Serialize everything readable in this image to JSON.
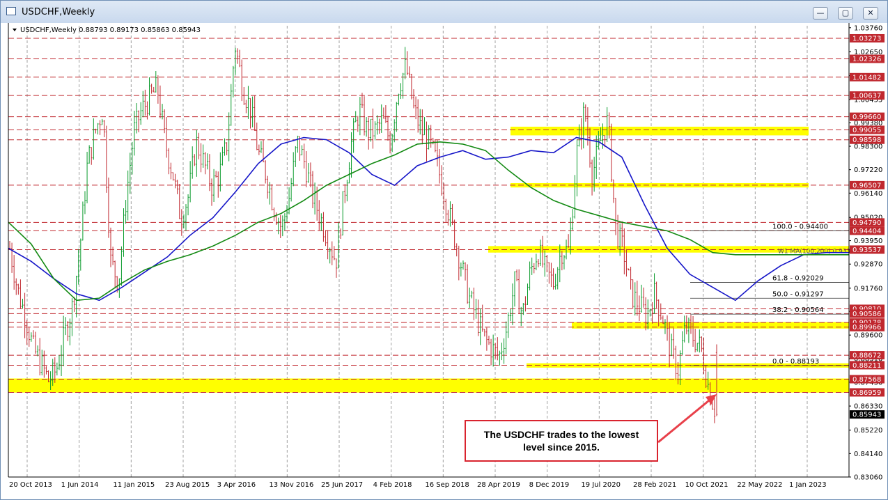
{
  "window": {
    "title": "USDCHF,Weekly",
    "buttons": {
      "minimize": "—",
      "maximize": "▢",
      "close": "✕"
    }
  },
  "colors": {
    "bull_candle": "#0a9b2c",
    "bear_candle": "#c0282f",
    "ma_blue": "#1515c8",
    "ma_green": "#138a13",
    "level_line": "#c0282f",
    "zone_yellow": "#ffff00",
    "price_tag": "#c0282f",
    "current_tag": "#000000"
  },
  "chart_data": {
    "type": "candlestick",
    "symbol": "USDCHF",
    "timeframe": "Weekly",
    "header": "USDCHF,Weekly  0.88793 0.89173 0.85863 0.85943",
    "ohlc_last": {
      "open": 0.88793,
      "high": 0.89173,
      "low": 0.85863,
      "close": 0.85943
    },
    "ylim": [
      0.8306,
      1.0385
    ],
    "y_ticks": [
      "1.03760",
      "1.02650",
      "1.01550",
      "1.00455",
      "0.99380",
      "0.98300",
      "0.97220",
      "0.96140",
      "0.95020",
      "0.93950",
      "0.92870",
      "0.91760",
      "0.90690",
      "0.89600",
      "0.88510",
      "0.87430",
      "0.86330",
      "0.85220",
      "0.84140",
      "0.83060"
    ],
    "x_labels": [
      "20 Oct 2013",
      "1 Jun 2014",
      "11 Jan 2015",
      "23 Aug 2015",
      "3 Apr 2016",
      "13 Nov 2016",
      "25 Jun 2017",
      "4 Feb 2018",
      "16 Sep 2018",
      "28 Apr 2019",
      "8 Dec 2019",
      "19 Jul 2020",
      "28 Feb 2021",
      "10 Oct 2021",
      "22 May 2022",
      "1 Jan 2023"
    ],
    "levels": [
      {
        "value": 1.03273,
        "label": "1.03273"
      },
      {
        "value": 1.02326,
        "label": "1.02326"
      },
      {
        "value": 1.01482,
        "label": "1.01482"
      },
      {
        "value": 1.00637,
        "label": "1.00637"
      },
      {
        "value": 0.9966,
        "label": "0.99660"
      },
      {
        "value": 0.99055,
        "label": "0.99055"
      },
      {
        "value": 0.98598,
        "label": "0.98598"
      },
      {
        "value": 0.96507,
        "label": "0.96507"
      },
      {
        "value": 0.9479,
        "label": "0.94790"
      },
      {
        "value": 0.94404,
        "label": "0.94404"
      },
      {
        "value": 0.93537,
        "label": "0.93537"
      },
      {
        "value": 0.9081,
        "label": "0.90810"
      },
      {
        "value": 0.90586,
        "label": "0.90586"
      },
      {
        "value": 0.90178,
        "label": "0.90178"
      },
      {
        "value": 0.89966,
        "label": "0.89966"
      },
      {
        "value": 0.88672,
        "label": "0.88672"
      },
      {
        "value": 0.88211,
        "label": "0.88211"
      },
      {
        "value": 0.87568,
        "label": "0.87568"
      },
      {
        "value": 0.86959,
        "label": "0.86959"
      }
    ],
    "current_price": {
      "value": 0.85943,
      "label": "0.85943"
    },
    "zones": [
      {
        "from": 0.988,
        "to": 0.992
      },
      {
        "from": 0.964,
        "to": 0.966
      },
      {
        "from": 0.934,
        "to": 0.937
      },
      {
        "from": 0.899,
        "to": 0.902
      },
      {
        "from": 0.881,
        "to": 0.883
      },
      {
        "from": 0.8695,
        "to": 0.876
      }
    ],
    "fibonacci": [
      {
        "label": "100.0 - 0.94400",
        "value": 0.944
      },
      {
        "label": "61.8 - 0.92029",
        "value": 0.92029
      },
      {
        "label": "50.0 - 0.91297",
        "value": 0.91297
      },
      {
        "label": "38.2 - 0.90564",
        "value": 0.90564
      },
      {
        "label": "0.0 - 0.88193",
        "value": 0.88193
      }
    ],
    "ma_overlay_label": "W1 MA(100,200) 0.93345",
    "moving_averages": [
      {
        "color": "blue",
        "values": [
          0.936,
          0.93,
          0.922,
          0.915,
          0.912,
          0.918,
          0.925,
          0.932,
          0.942,
          0.95,
          0.962,
          0.975,
          0.984,
          0.987,
          0.986,
          0.98,
          0.97,
          0.965,
          0.974,
          0.978,
          0.981,
          0.977,
          0.978,
          0.981,
          0.98,
          0.987,
          0.985,
          0.978,
          0.956,
          0.936,
          0.924,
          0.918,
          0.912,
          0.921,
          0.928,
          0.933,
          0.934,
          0.934
        ]
      },
      {
        "color": "green",
        "values": [
          0.948,
          0.938,
          0.922,
          0.912,
          0.913,
          0.92,
          0.926,
          0.93,
          0.933,
          0.937,
          0.942,
          0.948,
          0.952,
          0.958,
          0.965,
          0.97,
          0.975,
          0.979,
          0.984,
          0.985,
          0.984,
          0.981,
          0.972,
          0.964,
          0.958,
          0.954,
          0.951,
          0.948,
          0.946,
          0.944,
          0.94,
          0.934,
          0.933,
          0.933,
          0.933,
          0.933,
          0.933,
          0.933
        ]
      }
    ],
    "price_path": [
      0.936,
      0.917,
      0.905,
      0.89,
      0.883,
      0.875,
      0.88,
      0.895,
      0.908,
      0.935,
      0.975,
      0.99,
      1.0,
      0.93,
      0.92,
      0.96,
      0.99,
      1.0,
      1.005,
      1.01,
      0.985,
      0.97,
      0.95,
      0.96,
      0.985,
      0.975,
      0.965,
      0.97,
      0.985,
      1.03,
      1.01,
      1.0,
      0.98,
      0.97,
      0.955,
      0.945,
      0.96,
      0.985,
      0.975,
      0.96,
      0.95,
      0.94,
      0.93,
      0.96,
      0.985,
      1.0,
      0.99,
      0.99,
      0.995,
      0.985,
      1.01,
      1.02,
      1.0,
      0.99,
      0.985,
      0.975,
      0.96,
      0.945,
      0.93,
      0.915,
      0.905,
      0.895,
      0.89,
      0.886,
      0.9,
      0.92,
      0.905,
      0.925,
      0.935,
      0.925,
      0.92,
      0.935,
      0.935,
      0.98,
      1.0,
      0.97,
      0.985,
      0.995,
      0.945,
      0.935,
      0.915,
      0.91,
      0.905,
      0.915,
      0.905,
      0.89,
      0.88,
      0.9,
      0.895,
      0.89,
      0.871,
      0.859
    ]
  },
  "annotation": {
    "text": "The USDCHF trades to the lowest level since 2015."
  }
}
